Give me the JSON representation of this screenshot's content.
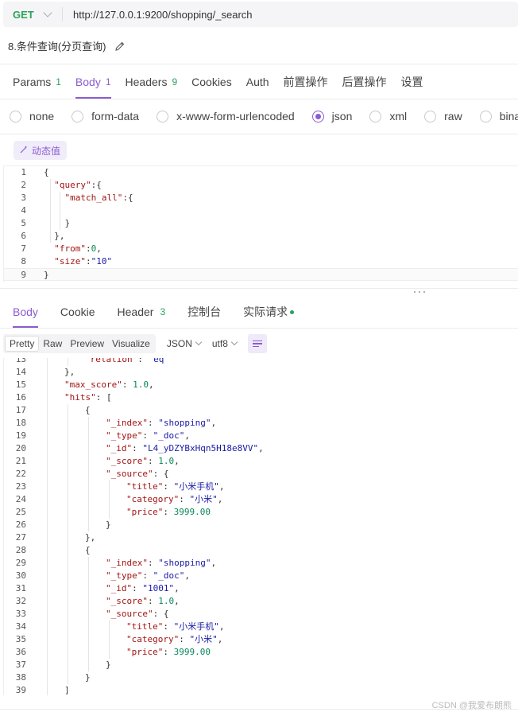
{
  "request": {
    "method": "GET",
    "url": "http://127.0.0.1:9200/shopping/_search",
    "name": "8.条件查询(分页查询)"
  },
  "req_tabs": [
    {
      "label": "Params",
      "count": "1"
    },
    {
      "label": "Body",
      "count": "1"
    },
    {
      "label": "Headers",
      "count": "9"
    },
    {
      "label": "Cookies",
      "count": ""
    },
    {
      "label": "Auth",
      "count": ""
    },
    {
      "label": "前置操作",
      "count": ""
    },
    {
      "label": "后置操作",
      "count": ""
    },
    {
      "label": "设置",
      "count": ""
    }
  ],
  "active_req_tab": "Body",
  "body_types": [
    "none",
    "form-data",
    "x-www-form-urlencoded",
    "json",
    "xml",
    "raw",
    "binary"
  ],
  "selected_body_type": "json",
  "dynamic_value_label": "动态值",
  "request_body_lines": [
    "{",
    "  \"query\":{",
    "    \"match_all\":{",
    "",
    "    }",
    "  },",
    "  \"from\":0,",
    "  \"size\":\"10\"",
    "}"
  ],
  "resp_tabs": [
    {
      "label": "Body",
      "count": ""
    },
    {
      "label": "Cookie",
      "count": ""
    },
    {
      "label": "Header",
      "count": "3"
    },
    {
      "label": "控制台",
      "count": ""
    },
    {
      "label": "实际请求",
      "count": ""
    }
  ],
  "active_resp_tab": "Body",
  "view_modes": [
    "Pretty",
    "Raw",
    "Preview",
    "Visualize"
  ],
  "active_view_mode": "Pretty",
  "format_select": "JSON",
  "encoding_select": "utf8",
  "response_start_line": 13,
  "response_lines": [
    {
      "indent": 3,
      "text": "\"relation\": \"eq\""
    },
    {
      "indent": 2,
      "text": "},"
    },
    {
      "indent": 2,
      "text": "\"max_score\": 1.0,"
    },
    {
      "indent": 2,
      "text": "\"hits\": ["
    },
    {
      "indent": 3,
      "text": "{"
    },
    {
      "indent": 4,
      "text": "\"_index\": \"shopping\","
    },
    {
      "indent": 4,
      "text": "\"_type\": \"_doc\","
    },
    {
      "indent": 4,
      "text": "\"_id\": \"L4_yDZYBxHqn5H18e8VV\","
    },
    {
      "indent": 4,
      "text": "\"_score\": 1.0,"
    },
    {
      "indent": 4,
      "text": "\"_source\": {"
    },
    {
      "indent": 5,
      "text": "\"title\": \"小米手机\","
    },
    {
      "indent": 5,
      "text": "\"category\": \"小米\","
    },
    {
      "indent": 5,
      "text": "\"price\": 3999.00"
    },
    {
      "indent": 4,
      "text": "}"
    },
    {
      "indent": 3,
      "text": "},"
    },
    {
      "indent": 3,
      "text": "{"
    },
    {
      "indent": 4,
      "text": "\"_index\": \"shopping\","
    },
    {
      "indent": 4,
      "text": "\"_type\": \"_doc\","
    },
    {
      "indent": 4,
      "text": "\"_id\": \"1001\","
    },
    {
      "indent": 4,
      "text": "\"_score\": 1.0,"
    },
    {
      "indent": 4,
      "text": "\"_source\": {"
    },
    {
      "indent": 5,
      "text": "\"title\": \"小米手机\","
    },
    {
      "indent": 5,
      "text": "\"category\": \"小米\","
    },
    {
      "indent": 5,
      "text": "\"price\": 3999.00"
    },
    {
      "indent": 4,
      "text": "}"
    },
    {
      "indent": 3,
      "text": "}"
    },
    {
      "indent": 2,
      "text": "]"
    }
  ],
  "watermark": "CSDN @我爱布朗熊",
  "colors": {
    "accent": "#8a5cd0",
    "method_get": "#29a35a",
    "count_badge": "#29a35a",
    "json_key": "#a31515",
    "json_string": "#1a1aa6",
    "json_number": "#098658"
  }
}
